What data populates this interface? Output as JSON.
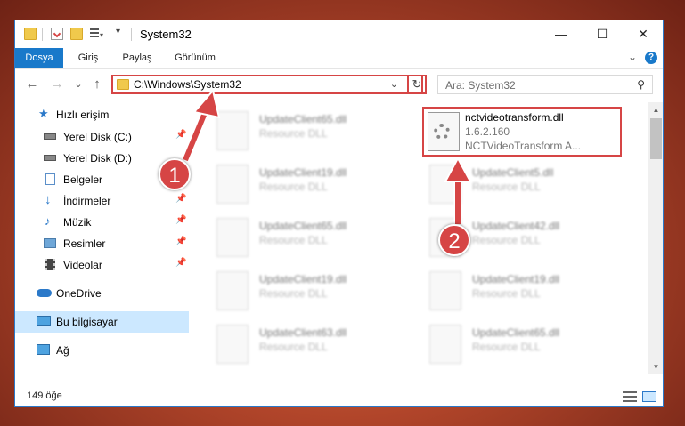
{
  "window": {
    "title": "System32",
    "close_glyph": "✕",
    "maximize_glyph": "☐",
    "minimize_glyph": "—"
  },
  "ribbon": {
    "tabs": [
      "Dosya",
      "Giriş",
      "Paylaş",
      "Görünüm"
    ],
    "expand_glyph": "⌄",
    "help_glyph": "?"
  },
  "nav": {
    "back_glyph": "←",
    "forward_glyph": "→",
    "recent_glyph": "⌄",
    "up_glyph": "↑",
    "address": "C:\\Windows\\System32",
    "address_chevron": "⌄",
    "refresh_glyph": "↻",
    "search_placeholder": "Ara: System32",
    "search_glyph": "⚲"
  },
  "sidebar": {
    "items": [
      {
        "label": "Hızlı erişim",
        "icon": "star-icon",
        "pinned": false
      },
      {
        "label": "Yerel Disk (C:)",
        "icon": "drive-icon",
        "pinned": true
      },
      {
        "label": "Yerel Disk (D:)",
        "icon": "drive-icon",
        "pinned": false
      },
      {
        "label": "Belgeler",
        "icon": "document-icon",
        "pinned": true
      },
      {
        "label": "İndirmeler",
        "icon": "download-icon",
        "pinned": true
      },
      {
        "label": "Müzik",
        "icon": "music-icon",
        "pinned": true
      },
      {
        "label": "Resimler",
        "icon": "picture-icon",
        "pinned": true
      },
      {
        "label": "Videolar",
        "icon": "video-icon",
        "pinned": true
      },
      {
        "label": "OneDrive",
        "icon": "cloud-icon",
        "pinned": false
      },
      {
        "label": "Bu bilgisayar",
        "icon": "computer-icon",
        "pinned": false,
        "selected": true
      },
      {
        "label": "Ağ",
        "icon": "network-icon",
        "pinned": false
      }
    ]
  },
  "files": {
    "left": [
      {
        "name": "UpdateClient65.dll",
        "type": "Resource DLL"
      },
      {
        "name": "UpdateClient19.dll",
        "type": "Resource DLL"
      },
      {
        "name": "UpdateClient65.dll",
        "type": "Resource DLL"
      },
      {
        "name": "UpdateClient19.dll",
        "type": "Resource DLL"
      },
      {
        "name": "UpdateClient63.dll",
        "type": "Resource DLL"
      }
    ],
    "right": [
      {
        "name": "nctvideotransform.dll",
        "type": "1.6.2.160",
        "desc": "NCTVideoTransform A...",
        "highlighted": true
      },
      {
        "name": "UpdateClient5.dll",
        "type": "Resource DLL"
      },
      {
        "name": "UpdateClient42.dll",
        "type": "Resource DLL"
      },
      {
        "name": "UpdateClient19.dll",
        "type": "Resource DLL"
      },
      {
        "name": "UpdateClient65.dll",
        "type": "Resource DLL"
      }
    ]
  },
  "status": {
    "item_count": "149 öğe"
  },
  "annotations": {
    "callout_1": "1",
    "callout_2": "2",
    "color": "#d64545"
  },
  "colors": {
    "accent": "#1979ca",
    "selection": "#cce8ff",
    "highlight_red": "#d64545"
  }
}
